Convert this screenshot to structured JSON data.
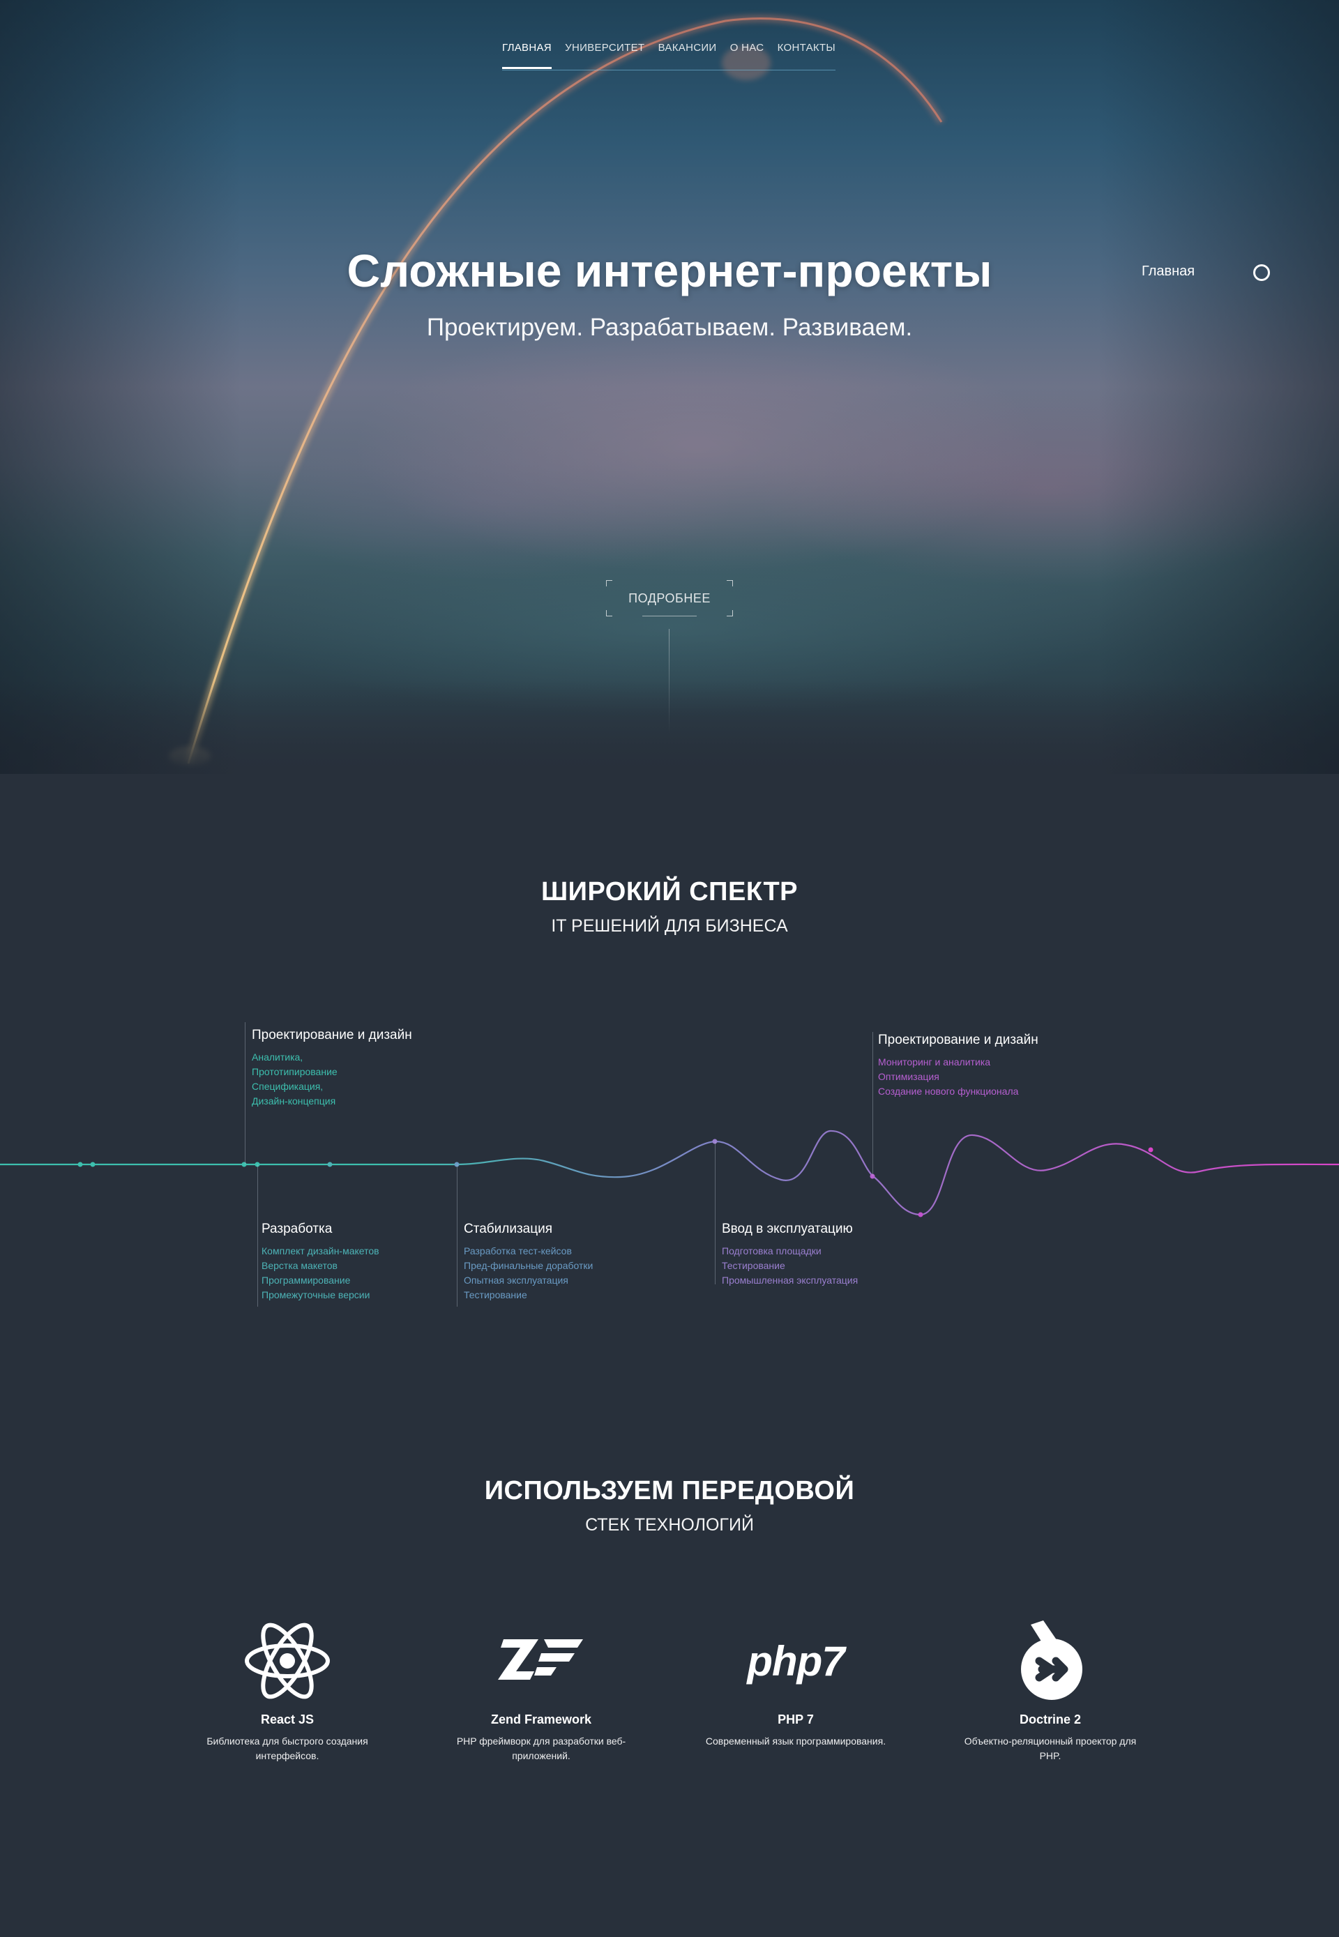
{
  "nav": {
    "items": [
      {
        "label": "ГЛАВНАЯ",
        "active": true
      },
      {
        "label": "УНИВЕРСИТЕТ",
        "active": false
      },
      {
        "label": "ВАКАНСИИ",
        "active": false
      },
      {
        "label": "О НАС",
        "active": false
      },
      {
        "label": "КОНТАКТЫ",
        "active": false
      }
    ]
  },
  "hero": {
    "title": "Сложные интернет-проекты",
    "subtitle": "Проектируем. Разрабатываем. Развиваем.",
    "side_label": "Главная",
    "more_button": "ПОДРОБНЕЕ"
  },
  "spectrum": {
    "title": "ШИРОКИЙ СПЕКТР",
    "subtitle": "IT РЕШЕНИЙ ДЛЯ БИЗНЕСА",
    "stages": [
      {
        "title": "Проектирование и дизайн",
        "items": [
          "Аналитика,",
          "Прототипирование",
          "Спецификация,",
          "Дизайн-концепция"
        ]
      },
      {
        "title": "Разработка",
        "items": [
          "Комплект дизайн-макетов",
          "Верстка макетов",
          "Программирование",
          "Промежуточные версии"
        ]
      },
      {
        "title": "Стабилизация",
        "items": [
          "Разработка тест-кейсов",
          "Пред-финальные доработки",
          "Опытная эксплуатация",
          "Тестирование"
        ]
      },
      {
        "title": "Ввод в эксплуатацию",
        "items": [
          "Подготовка площадки",
          "Тестирование",
          "Промышленная эксплуатация"
        ]
      },
      {
        "title": "Проектирование и дизайн",
        "items": [
          "Мониторинг и аналитика",
          "Оптимизация",
          "Создание нового функционала"
        ]
      }
    ],
    "colors": {
      "start": "#3dbfae",
      "mid": "#7f86c8",
      "end": "#d845c8"
    }
  },
  "stack": {
    "title": "ИСПОЛЬЗУЕМ ПЕРЕДОВОЙ",
    "subtitle": "СТЕК ТЕХНОЛОГИЙ",
    "items": [
      {
        "name": "React JS",
        "desc": "Библиотека для быстрого создания интерфейсов.",
        "icon": "react-logo"
      },
      {
        "name": "Zend Framework",
        "desc": "PHP фреймворк для разработки веб-приложений.",
        "icon": "zend-logo"
      },
      {
        "name": "PHP 7",
        "desc": "Современный язык программирования.",
        "icon": "php7-logo",
        "logo_text": "php7"
      },
      {
        "name": "Doctrine 2",
        "desc": "Объектно-реляционный проектор для PHP.",
        "icon": "doctrine-logo"
      }
    ]
  }
}
